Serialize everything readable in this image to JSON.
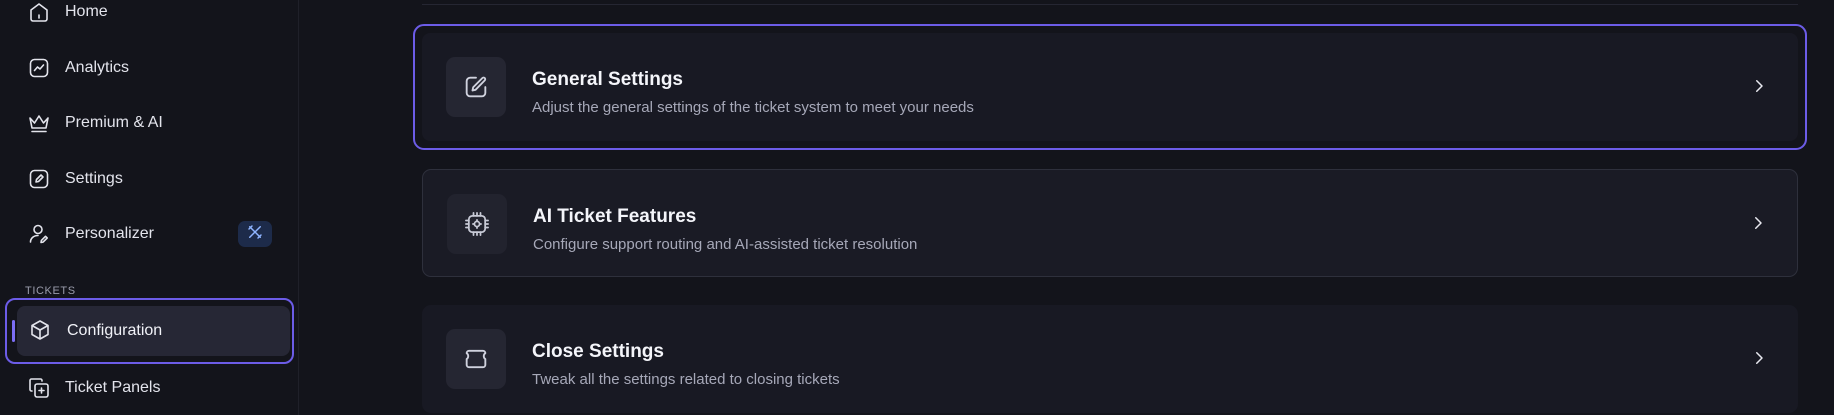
{
  "sidebar": {
    "items": [
      {
        "label": "Home",
        "icon": "home-icon"
      },
      {
        "label": "Analytics",
        "icon": "analytics-icon"
      },
      {
        "label": "Premium & AI",
        "icon": "crown-icon"
      },
      {
        "label": "Settings",
        "icon": "settings-edit-icon"
      },
      {
        "label": "Personalizer",
        "icon": "user-edit-icon",
        "badge_icon": "tools-icon"
      }
    ],
    "section_label": "TICKETS",
    "ticket_items": [
      {
        "label": "Configuration",
        "icon": "cube-icon",
        "active": true
      },
      {
        "label": "Ticket Panels",
        "icon": "add-panel-icon"
      }
    ]
  },
  "cards": [
    {
      "title": "General Settings",
      "description": "Adjust the general settings of the ticket system to meet your needs",
      "icon": "edit-square-icon"
    },
    {
      "title": "AI Ticket Features",
      "description": "Configure support routing and AI-assisted ticket resolution",
      "icon": "chip-gear-icon"
    },
    {
      "title": "Close Settings",
      "description": "Tweak all the settings related to closing tickets",
      "icon": "ticket-icon"
    }
  ],
  "colors": {
    "accent": "#6c5ce7",
    "background": "#13141b",
    "card": "#181923",
    "badge": "#1d2b4a"
  }
}
